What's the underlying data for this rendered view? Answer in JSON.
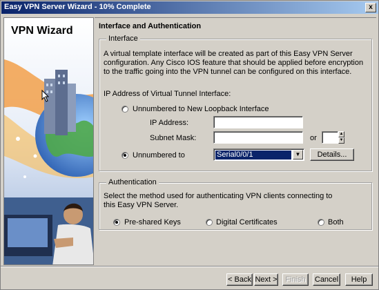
{
  "window": {
    "title": "Easy VPN Server Wizard - 10% Complete",
    "close_glyph": "x"
  },
  "sidebar": {
    "label": "VPN Wizard"
  },
  "main": {
    "heading": "Interface and Authentication",
    "interface": {
      "legend": "Interface",
      "description": "A virtual template interface will be created as part of this Easy VPN Server configuration. Any Cisco IOS feature that should be applied before encryption to the traffic going into the VPN tunnel can be configured on this interface.",
      "ip_section_label": "IP Address of Virtual Tunnel Interface:",
      "option_loopback": "Unnumbered to New Loopback Interface",
      "ip_address_label": "IP Address:",
      "ip_address_value": "",
      "subnet_mask_label": "Subnet Mask:",
      "subnet_mask_value": "",
      "or_label": "or",
      "prefix_value": "",
      "option_unnumbered": "Unnumbered to",
      "unnumbered_selected": "Serial0/0/1",
      "details_button": "Details..."
    },
    "authentication": {
      "legend": "Authentication",
      "description": "Select the method used for authenticating VPN clients connecting to this Easy VPN Server.",
      "option_preshared": "Pre-shared Keys",
      "option_certificates": "Digital Certificates",
      "option_both": "Both",
      "selected": "Pre-shared Keys"
    }
  },
  "footer": {
    "back": "< Back",
    "next": "Next >",
    "finish": "Finish",
    "cancel": "Cancel",
    "help": "Help"
  }
}
